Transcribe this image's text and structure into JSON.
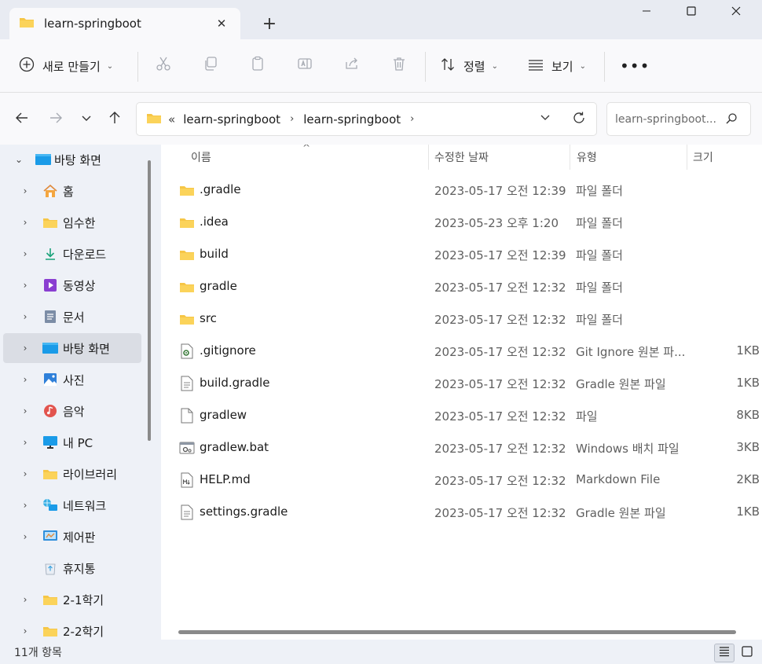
{
  "window": {
    "tab_title": "learn-springboot",
    "tab_close": "✕",
    "new_tab": "+"
  },
  "toolbar": {
    "new_label": "새로 만들기",
    "sort_label": "정렬",
    "view_label": "보기",
    "more_label": "•••"
  },
  "address": {
    "overflow": "«",
    "crumbs": [
      "learn-springboot",
      "learn-springboot"
    ],
    "search_placeholder": "learn-springboot..."
  },
  "sidebar": {
    "root_label": "바탕 화면",
    "items": [
      {
        "label": "홈",
        "icon": "home-icon"
      },
      {
        "label": "임수한",
        "icon": "folder-icon"
      },
      {
        "label": "다운로드",
        "icon": "download-icon"
      },
      {
        "label": "동영상",
        "icon": "video-icon"
      },
      {
        "label": "문서",
        "icon": "document-icon"
      },
      {
        "label": "바탕 화면",
        "icon": "desktop-icon"
      },
      {
        "label": "사진",
        "icon": "pictures-icon"
      },
      {
        "label": "음악",
        "icon": "music-icon"
      },
      {
        "label": "내 PC",
        "icon": "pc-icon"
      },
      {
        "label": "라이브러리",
        "icon": "folder-icon"
      },
      {
        "label": "네트워크",
        "icon": "network-icon"
      },
      {
        "label": "제어판",
        "icon": "control-panel-icon"
      },
      {
        "label": "휴지통",
        "icon": "recycle-bin-icon"
      },
      {
        "label": "2-1학기",
        "icon": "folder-icon"
      },
      {
        "label": "2-2학기",
        "icon": "folder-icon"
      }
    ]
  },
  "columns": {
    "name": "이름",
    "date": "수정한 날짜",
    "type": "유형",
    "size": "크기"
  },
  "files": [
    {
      "name": ".gradle",
      "date": "2023-05-17 오전 12:39",
      "type": "파일 폴더",
      "size": "",
      "icon": "folder-icon"
    },
    {
      "name": ".idea",
      "date": "2023-05-23 오후 1:20",
      "type": "파일 폴더",
      "size": "",
      "icon": "folder-icon"
    },
    {
      "name": "build",
      "date": "2023-05-17 오전 12:39",
      "type": "파일 폴더",
      "size": "",
      "icon": "folder-icon"
    },
    {
      "name": "gradle",
      "date": "2023-05-17 오전 12:32",
      "type": "파일 폴더",
      "size": "",
      "icon": "folder-icon"
    },
    {
      "name": "src",
      "date": "2023-05-17 오전 12:32",
      "type": "파일 폴더",
      "size": "",
      "icon": "folder-icon"
    },
    {
      "name": ".gitignore",
      "date": "2023-05-17 오전 12:32",
      "type": "Git Ignore 원본 파...",
      "size": "1KB",
      "icon": "settings-file-icon"
    },
    {
      "name": "build.gradle",
      "date": "2023-05-17 오전 12:32",
      "type": "Gradle 원본 파일",
      "size": "1KB",
      "icon": "text-file-icon"
    },
    {
      "name": "gradlew",
      "date": "2023-05-17 오전 12:32",
      "type": "파일",
      "size": "8KB",
      "icon": "blank-file-icon"
    },
    {
      "name": "gradlew.bat",
      "date": "2023-05-17 오전 12:32",
      "type": "Windows 배치 파일",
      "size": "3KB",
      "icon": "batch-file-icon"
    },
    {
      "name": "HELP.md",
      "date": "2023-05-17 오전 12:32",
      "type": "Markdown File",
      "size": "2KB",
      "icon": "markdown-file-icon"
    },
    {
      "name": "settings.gradle",
      "date": "2023-05-17 오전 12:32",
      "type": "Gradle 원본 파일",
      "size": "1KB",
      "icon": "text-file-icon"
    }
  ],
  "status": {
    "count": "11개 항목"
  }
}
